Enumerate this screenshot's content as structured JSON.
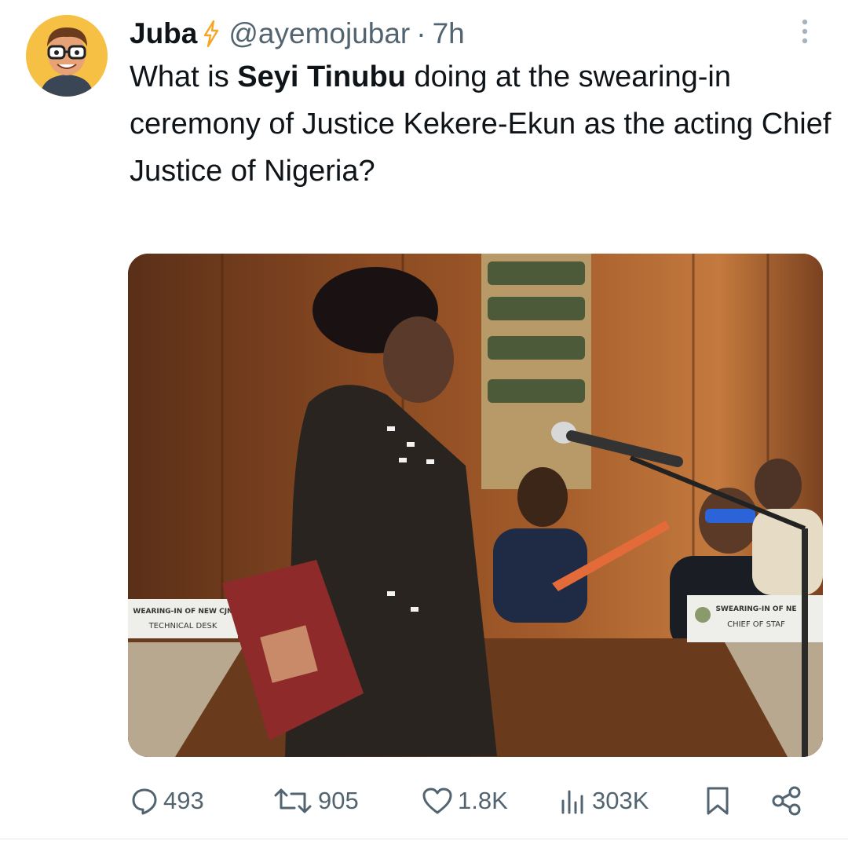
{
  "tweet": {
    "author_name": "Juba",
    "author_handle": "@ayemojubar",
    "separator": "·",
    "time": "7h",
    "text_before": "What is ",
    "text_bold": "Seyi Tinubu",
    "text_after": " doing at the swearing-in ceremony of Justice Kekere-Ekun as the acting Chief Justice of Nigeria?"
  },
  "media": {
    "left_sign": {
      "line1": "WEARING-IN OF NEW CJN",
      "line2": "TECHNICAL DESK"
    },
    "right_sign": {
      "line1": "SWEARING-IN OF NE",
      "line2": "CHIEF OF STAF"
    }
  },
  "actions": {
    "replies": "493",
    "reposts": "905",
    "likes": "1.8K",
    "views": "303K"
  },
  "icons": {
    "verified": "lightning-bolt-icon",
    "more": "more-vertical-icon",
    "reply": "reply-icon",
    "repost": "repost-icon",
    "like": "heart-icon",
    "views": "views-icon",
    "bookmark": "bookmark-icon",
    "share": "share-icon"
  },
  "colors": {
    "secondary_text": "#536471",
    "bolt": "#f5a623",
    "avatar_bg": "#f5c043"
  }
}
